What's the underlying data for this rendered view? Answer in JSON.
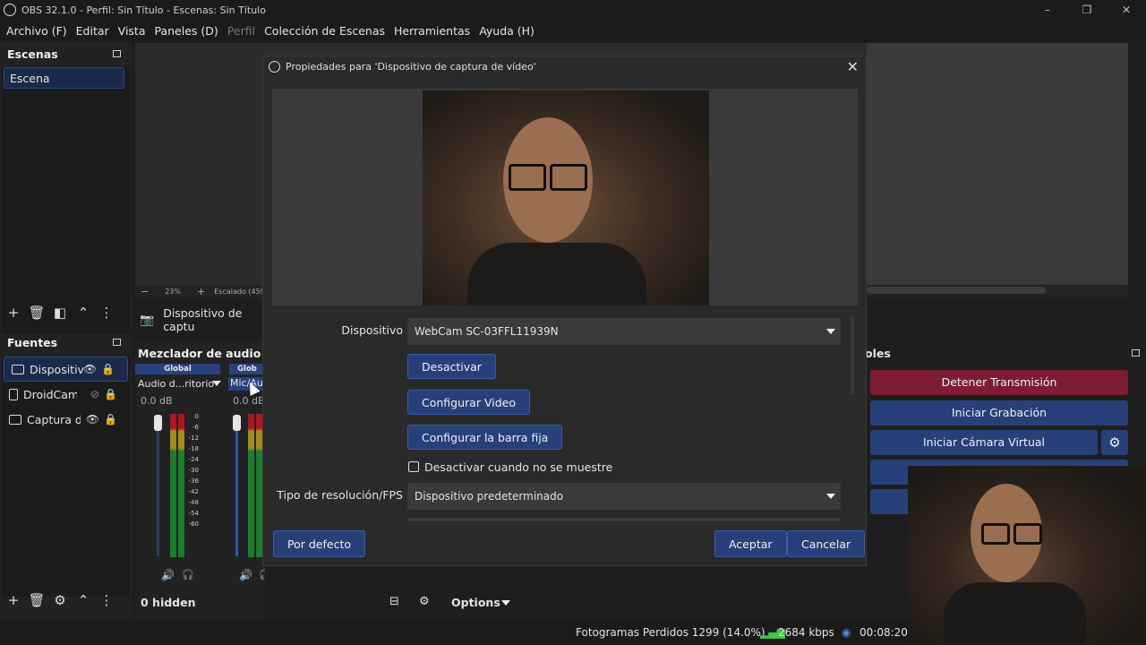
{
  "window": {
    "title": "OBS 32.1.0 - Perfil: Sin Título - Escenas: Sin Título",
    "min": "–",
    "restore": "❐",
    "close": "✕"
  },
  "menu": [
    {
      "label": "Archivo (F)",
      "enabled": true
    },
    {
      "label": "Editar",
      "enabled": true
    },
    {
      "label": "Vista",
      "enabled": true
    },
    {
      "label": "Paneles (D)",
      "enabled": true
    },
    {
      "label": "Perfil",
      "enabled": false
    },
    {
      "label": "Colección de Escenas",
      "enabled": true
    },
    {
      "label": "Herramientas",
      "enabled": true
    },
    {
      "label": "Ayuda (H)",
      "enabled": true
    }
  ],
  "scenes": {
    "title": "Escenas",
    "items": [
      "Escena"
    ],
    "toolbar": {
      "add": "+",
      "remove": "🗑",
      "filter": "◧",
      "up": "⌃",
      "more": "⋮"
    }
  },
  "sources": {
    "title": "Fuentes",
    "items": [
      {
        "label": "Dispositiv",
        "icon": "camera-icon",
        "visible": true,
        "selected": true
      },
      {
        "label": "DroidCam",
        "icon": "phone-icon",
        "visible": false,
        "selected": false
      },
      {
        "label": "Captura d",
        "icon": "monitor-icon",
        "visible": true,
        "selected": false
      }
    ],
    "toolbar": {
      "add": "+",
      "remove": "🗑",
      "settings": "⚙",
      "up": "⌃",
      "more": "⋮"
    }
  },
  "preview": {
    "zoom_minus": "−",
    "zoom": "23%",
    "zoom_plus": "+",
    "scale_label": "Escalado (459"
  },
  "source_strip": {
    "label": "Dispositivo de captu"
  },
  "mixer": {
    "title": "Mezclador de audio",
    "channels": [
      {
        "header": "Global",
        "name": "Audio d...ritorio",
        "db": "0.0 dB"
      },
      {
        "header": "Glob",
        "name": "Mic/Au",
        "db": "0.0 dB"
      }
    ],
    "scale": [
      "0",
      "-6",
      "-12",
      "-18",
      "-24",
      "-30",
      "-36",
      "-42",
      "-48",
      "-54",
      "-60"
    ],
    "hidden_label": "0 hidden",
    "options_label": "Options"
  },
  "controls": {
    "title": "oles",
    "buttons": [
      {
        "label": "Detener Transmisión",
        "color": "#7d1c32"
      },
      {
        "label": "Iniciar Grabación",
        "color": "#27407a"
      },
      {
        "label": "Iniciar Cámara Virtual",
        "color": "#27407a"
      }
    ],
    "gear": "⚙"
  },
  "dialog": {
    "title": "Propiedades para 'Dispositivo de captura de vídeo'",
    "close": "✕",
    "device_label": "Dispositivo",
    "device_value": "WebCam SC-03FFL11939N",
    "btn_deactivate": "Desactivar",
    "btn_config_video": "Configurar Video",
    "btn_config_bar": "Configurar la barra fija",
    "checkbox_label": "Desactivar cuando no se muestre",
    "checkbox_checked": false,
    "res_label": "Tipo de resolución/FPS",
    "res_value": "Dispositivo predeterminado",
    "btn_defaults": "Por defecto",
    "btn_accept": "Aceptar",
    "btn_cancel": "Cancelar"
  },
  "status": {
    "dropped": "Fotogramas Perdidos 1299 (14.0%)",
    "kbps": "2684 kbps",
    "time": "00:08:20"
  },
  "colors": {
    "accent_blue": "#27407a",
    "stop_red": "#7d1c32",
    "meter_green": "#1d7d2d"
  }
}
